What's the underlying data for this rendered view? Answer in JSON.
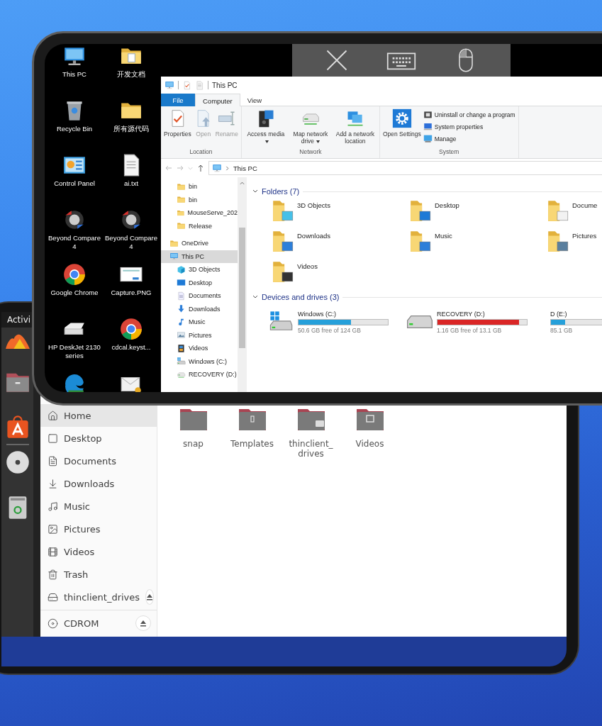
{
  "remote_toolbar": {
    "buttons": [
      {
        "kind": "close"
      },
      {
        "kind": "keyboard"
      },
      {
        "kind": "mouse"
      }
    ]
  },
  "desktop": {
    "icons": [
      {
        "label": "This PC",
        "kind": "pc"
      },
      {
        "label": "开发文档",
        "kind": "folder_doc"
      },
      {
        "label": "Recycle Bin",
        "kind": "recycle"
      },
      {
        "label": "所有源代码",
        "kind": "folder"
      },
      {
        "label": "Control Panel",
        "kind": "control"
      },
      {
        "label": "ai.txt",
        "kind": "text"
      },
      {
        "label": "Beyond Compare 4",
        "kind": "compare"
      },
      {
        "label": "Beyond Compare 4",
        "kind": "compare"
      },
      {
        "label": "Google Chrome",
        "kind": "chrome"
      },
      {
        "label": "Capture.PNG",
        "kind": "image"
      },
      {
        "label": "HP DeskJet 2130 series",
        "kind": "printer"
      },
      {
        "label": "cdcal.keyst...",
        "kind": "chrome"
      },
      {
        "kind": "edge"
      },
      {
        "kind": "mail"
      }
    ]
  },
  "explorer": {
    "title": "This PC",
    "tabs": [
      {
        "label": "File",
        "kind": "file",
        "selected": false
      },
      {
        "label": "Computer",
        "kind": "tab",
        "selected": true
      },
      {
        "label": "View",
        "kind": "tab",
        "selected": false
      }
    ],
    "ribbon": [
      {
        "label": "Location",
        "commands": [
          {
            "label": "Properties",
            "kind": "properties",
            "disabled": false,
            "dropdown": false
          },
          {
            "label": "Open",
            "kind": "open",
            "disabled": true,
            "dropdown": false
          },
          {
            "label": "Rename",
            "kind": "rename",
            "disabled": true,
            "dropdown": false
          }
        ]
      },
      {
        "label": "Network",
        "commands": [
          {
            "label": "Access media",
            "kind": "media",
            "disabled": false,
            "dropdown": true
          },
          {
            "label": "Map network drive",
            "kind": "drive",
            "disabled": false,
            "dropdown": true
          },
          {
            "label": "Add a network location",
            "kind": "network",
            "disabled": false,
            "dropdown": false
          }
        ]
      },
      {
        "label": "System",
        "commands": [
          {
            "label": "Open Settings",
            "kind": "settings",
            "disabled": false,
            "dropdown": false
          }
        ],
        "small_commands": [
          {
            "label": "Uninstall or change a program",
            "kind": "uninstall"
          },
          {
            "label": "System properties",
            "kind": "sysprops"
          },
          {
            "label": "Manage",
            "kind": "manage"
          }
        ]
      }
    ],
    "address": "This PC",
    "nav_pane": {
      "pinned": [
        {
          "label": "bin",
          "kind": "folder",
          "selected": false
        },
        {
          "label": "bin",
          "kind": "folder",
          "selected": false
        },
        {
          "label": "MouseServe_202",
          "kind": "folder",
          "selected": false
        },
        {
          "label": "Release",
          "kind": "folder",
          "selected": false
        }
      ],
      "tree": [
        {
          "label": "OneDrive",
          "kind": "folder",
          "selected": false
        },
        {
          "label": "This PC",
          "kind": "pc",
          "selected": true,
          "children": [
            {
              "label": "3D Objects",
              "kind": "objects",
              "selected": false
            },
            {
              "label": "Desktop",
              "kind": "desktop",
              "selected": false
            },
            {
              "label": "Documents",
              "kind": "documents",
              "selected": false
            },
            {
              "label": "Downloads",
              "kind": "downloads",
              "selected": false
            },
            {
              "label": "Music",
              "kind": "music",
              "selected": false
            },
            {
              "label": "Pictures",
              "kind": "pictures",
              "selected": false
            },
            {
              "label": "Videos",
              "kind": "videos",
              "selected": false
            },
            {
              "label": "Windows (C:)",
              "kind": "windows_drive",
              "selected": false
            },
            {
              "label": "RECOVERY (D:)",
              "kind": "drive",
              "selected": false
            }
          ]
        }
      ]
    },
    "sections": [
      {
        "title": "Folders (7)",
        "kind": "folders",
        "expanded": true,
        "items": [
          {
            "label": "3D Objects",
            "kind": "objects"
          },
          {
            "label": "Desktop",
            "kind": "desktop"
          },
          {
            "label": "Docume",
            "kind": "documents"
          },
          {
            "label": "Downloads",
            "kind": "downloads"
          },
          {
            "label": "Music",
            "kind": "music"
          },
          {
            "label": "Pictures",
            "kind": "pictures"
          },
          {
            "label": "Videos",
            "kind": "videos"
          }
        ]
      },
      {
        "title": "Devices and drives (3)",
        "kind": "drives",
        "expanded": true,
        "items": [
          {
            "label": "Windows (C:)",
            "kind": "windows_drive",
            "level": 0.59,
            "low_space": false,
            "free": "50.6 GB free of 124 GB"
          },
          {
            "label": "RECOVERY (D:)",
            "kind": "drive",
            "level": 0.91,
            "low_space": true,
            "free": "1.16 GB free of 13.1 GB"
          },
          {
            "label": "D (E:)",
            "kind": "drive",
            "level": 0.16,
            "low_space": false,
            "free": "85.1 GB"
          }
        ]
      }
    ]
  },
  "ubuntu": {
    "top_bar": "Activi",
    "dock": [
      {
        "kind": "browser"
      },
      {
        "kind": "files"
      },
      {
        "kind": "appstore"
      },
      {
        "kind": "separator"
      },
      {
        "kind": "disc"
      },
      {
        "kind": "trash"
      }
    ],
    "sidebar": {
      "places": [
        {
          "label": "Home",
          "kind": "home",
          "selected": true,
          "ejectable": false
        },
        {
          "label": "Desktop",
          "kind": "desktop",
          "selected": false,
          "ejectable": false
        },
        {
          "label": "Documents",
          "kind": "documents",
          "selected": false,
          "ejectable": false
        },
        {
          "label": "Downloads",
          "kind": "downloads",
          "selected": false,
          "ejectable": false
        },
        {
          "label": "Music",
          "kind": "music",
          "selected": false,
          "ejectable": false
        },
        {
          "label": "Pictures",
          "kind": "pictures",
          "selected": false,
          "ejectable": false
        },
        {
          "label": "Videos",
          "kind": "videos",
          "selected": false,
          "ejectable": false
        },
        {
          "label": "Trash",
          "kind": "trash",
          "selected": false,
          "ejectable": false
        },
        {
          "label": "thinclient_drives",
          "kind": "drive",
          "selected": false,
          "ejectable": true
        }
      ],
      "devices": [
        {
          "label": "CDROM",
          "kind": "disc",
          "selected": false,
          "ejectable": true
        }
      ]
    },
    "folders": [
      {
        "label": "snap",
        "kind": "plain"
      },
      {
        "label": "Templates",
        "kind": "templates"
      },
      {
        "label": "thinclient_\ndrives",
        "kind": "drive"
      },
      {
        "label": "Videos",
        "kind": "videos"
      }
    ]
  }
}
